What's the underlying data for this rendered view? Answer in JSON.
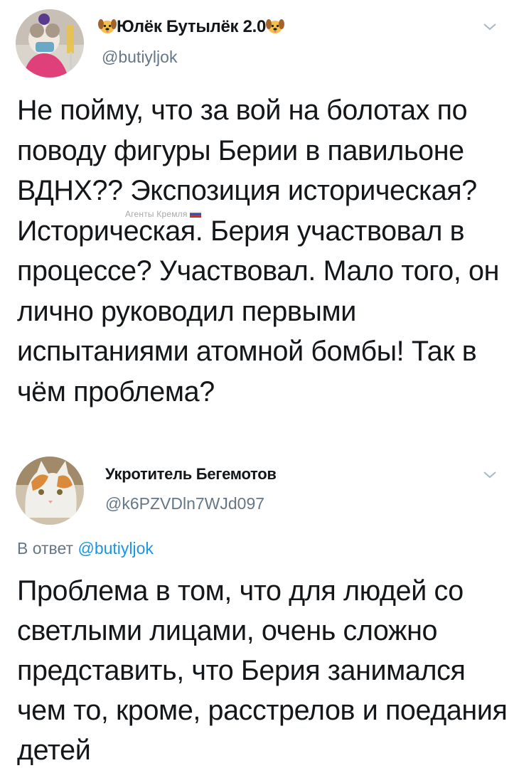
{
  "tweets": [
    {
      "display_name": "Юлёк Бутылёк 2.0",
      "handle": "@butiyljok",
      "text": "Не пойму, что за вой на болотах по поводу фигуры Берии в павильоне ВДНХ?? Экспозиция историческая? Историческая. Берия участвовал в процессе? Участвовал. Мало того, он лично руководил первыми испытаниями атомной бомбы! Так в чём проблема?",
      "emoji": "dog-face-icon"
    },
    {
      "display_name": "Укротитель Бегемотов",
      "handle": "@k6PZVDln7WJd097",
      "reply_prefix": "В ответ",
      "reply_to": "@butiyljok",
      "text": "Проблема в том, что для людей со светлыми лицами, очень сложно представить, что Берия занимался чем то, кроме, расстрелов и поедания детей"
    }
  ],
  "watermark": {
    "text": "Агенты Кремля",
    "icon": "russian-flag-icon"
  },
  "colors": {
    "text": "#14171a",
    "secondary": "#657786",
    "link": "#1b95e0"
  }
}
